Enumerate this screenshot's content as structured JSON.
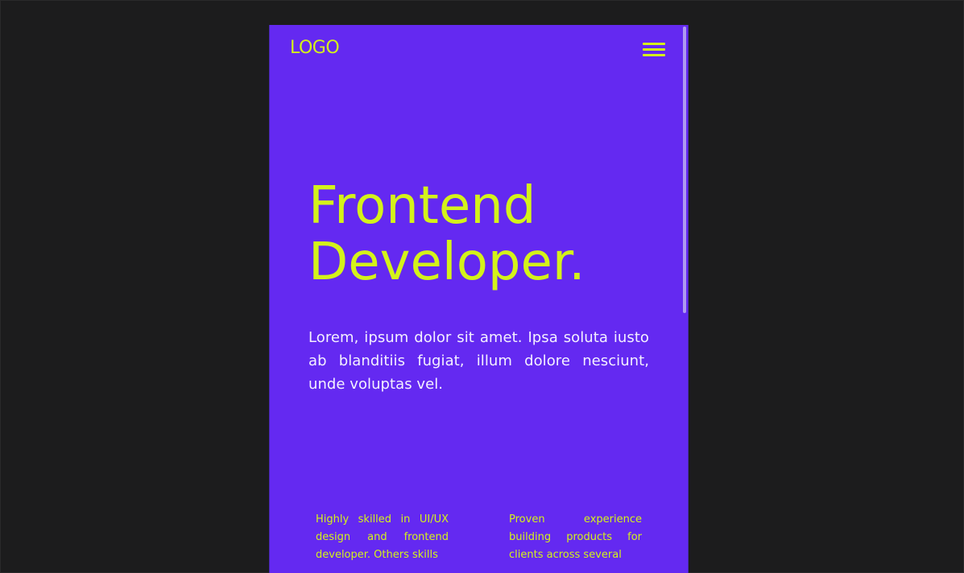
{
  "header": {
    "logo": "LOGO",
    "menu_icon": "hamburger-menu-icon"
  },
  "hero": {
    "title_line1": "Frontend",
    "title_line2": "Developer.",
    "description": "Lorem, ipsum dolor sit amet. Ipsa soluta iusto ab blanditiis fugiat, illum dolore nesciunt, unde voluptas vel."
  },
  "features": [
    {
      "text": "Highly skilled in UI/UX design and frontend developer. Others skills"
    },
    {
      "text": "Proven experience building products for clients across several"
    }
  ],
  "colors": {
    "background": "#1c1c1d",
    "page": "#6429f1",
    "accent": "#d4f21a",
    "text_light": "#f4f0ff"
  }
}
